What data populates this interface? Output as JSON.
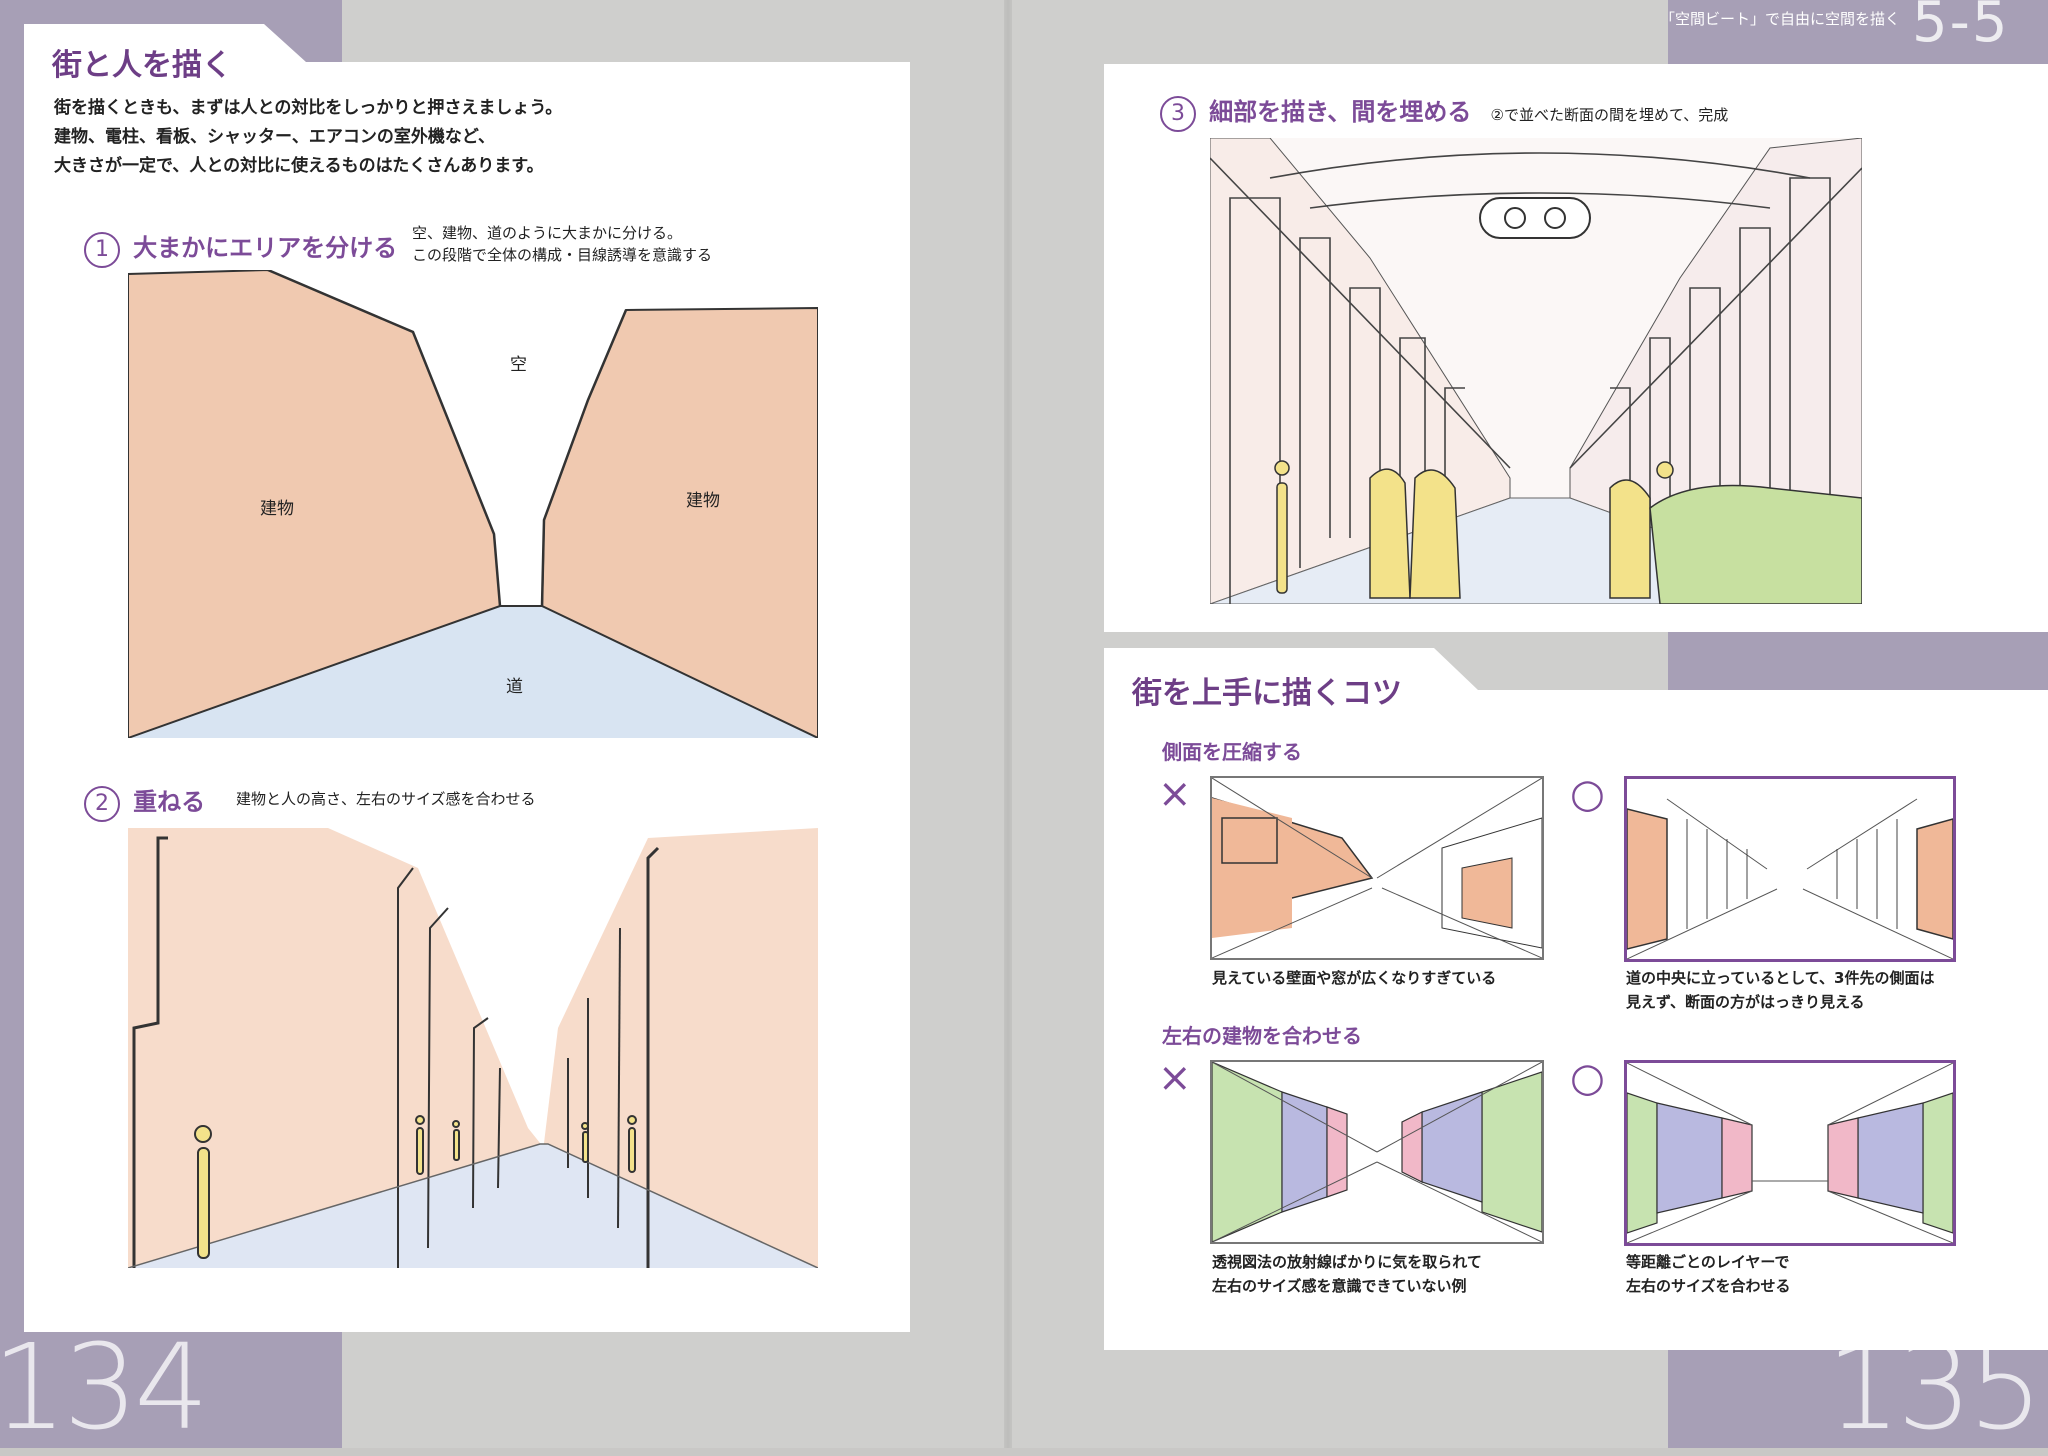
{
  "header": {
    "chapter_title": "「空間ビート」で自由に空間を描く",
    "chapter_number": "5-5"
  },
  "left_page": {
    "page_number": "134",
    "title": "街と人を描く",
    "intro_lines": [
      "街を描くときも、まずは人との対比をしっかりと押さえましょう。",
      "建物、電柱、看板、シャッター、エアコンの室外機など、",
      "大きさが一定で、人との対比に使えるものはたくさんあります。"
    ],
    "step1": {
      "number": "1",
      "title": "大まかにエリアを分ける",
      "note_lines": [
        "空、建物、道のように大まかに分ける。",
        "この段階で全体の構成・目線誘導を意識する"
      ],
      "labels": {
        "sky": "空",
        "building_left": "建物",
        "building_right": "建物",
        "road": "道"
      }
    },
    "step2": {
      "number": "2",
      "title": "重ねる",
      "note": "建物と人の高さ、左右のサイズ感を合わせる"
    }
  },
  "right_page": {
    "page_number": "135",
    "step3": {
      "number": "3",
      "title": "細部を描き、間を埋める",
      "note": "②で並べた断面の間を埋めて、完成"
    },
    "tips": {
      "title": "街を上手に描くコツ",
      "section1": {
        "heading": "側面を圧縮する",
        "bad_mark": "×",
        "good_mark": "○",
        "bad_caption": [
          "見えている壁面や窓が広くなりすぎている"
        ],
        "good_caption": [
          "道の中央に立っているとして、3件先の側面は",
          "見えず、断面の方がはっきり見える"
        ]
      },
      "section2": {
        "heading": "左右の建物を合わせる",
        "bad_mark": "×",
        "good_mark": "○",
        "bad_caption": [
          "透視図法の放射線ばかりに気を取られて",
          "左右のサイズ感を意識できていない例"
        ],
        "good_caption": [
          "等距離ごとのレイヤーで",
          "左右のサイズを合わせる"
        ]
      }
    }
  },
  "colors": {
    "accent": "#7c4b98",
    "band": "#a79fb6",
    "building": "#f0c9b0",
    "road": "#d8e4f2",
    "person": "#f3e28a",
    "car": "#c7e0a0"
  }
}
